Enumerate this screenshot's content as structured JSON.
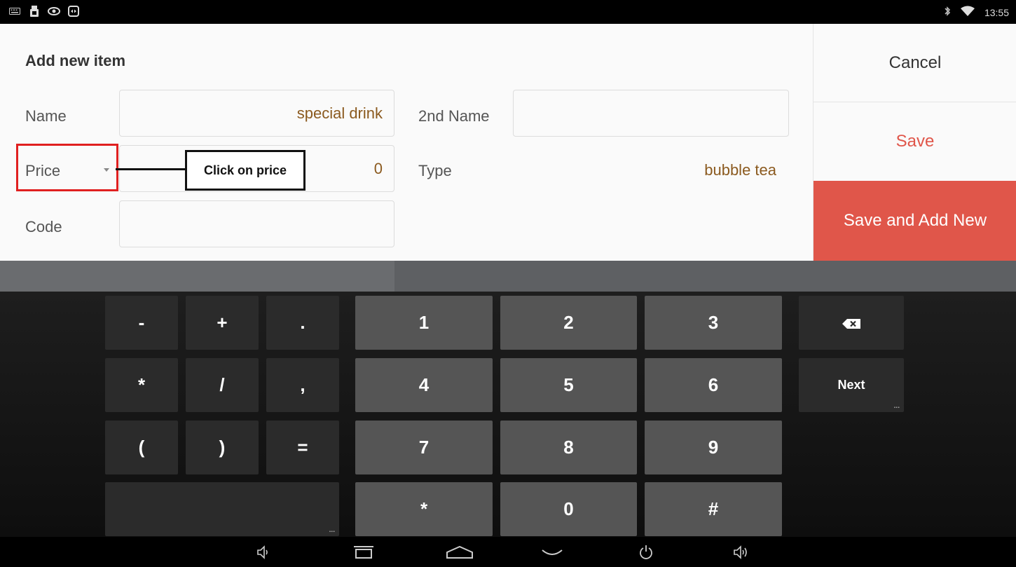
{
  "status_bar": {
    "icons": [
      "keyboard-icon",
      "usb-icon",
      "eye-icon",
      "teamviewer-icon"
    ],
    "right_icons": [
      "bluetooth-icon",
      "wifi-icon"
    ],
    "time": "13:55"
  },
  "form": {
    "title": "Add new item",
    "name_label": "Name",
    "name_value": "special drink",
    "second_name_label": "2nd Name",
    "second_name_value": "",
    "price_label": "Price",
    "price_value": "0",
    "type_label": "Type",
    "type_value": "bubble tea",
    "code_label": "Code",
    "code_value": ""
  },
  "annotation": {
    "callout_text": "Click on price",
    "highlight_color": "#e02020"
  },
  "actions": {
    "cancel": "Cancel",
    "save": "Save",
    "save_and_add_new": "Save and Add New",
    "accent_color": "#e0564a"
  },
  "keyboard": {
    "symbol_keys": [
      [
        "-",
        "+",
        "."
      ],
      [
        "*",
        "/",
        ","
      ],
      [
        "(",
        ")",
        "="
      ]
    ],
    "digit_keys": [
      [
        "1",
        "2",
        "3"
      ],
      [
        "4",
        "5",
        "6"
      ],
      [
        "7",
        "8",
        "9"
      ],
      [
        "*",
        "0",
        "#"
      ]
    ],
    "backspace_icon": "backspace-icon",
    "next_label": "Next",
    "corner_hint": "..."
  },
  "nav_bar": {
    "icons": [
      "volume-down-icon",
      "recent-apps-icon",
      "home-icon",
      "hide-keyboard-icon",
      "power-icon",
      "volume-up-icon"
    ]
  }
}
